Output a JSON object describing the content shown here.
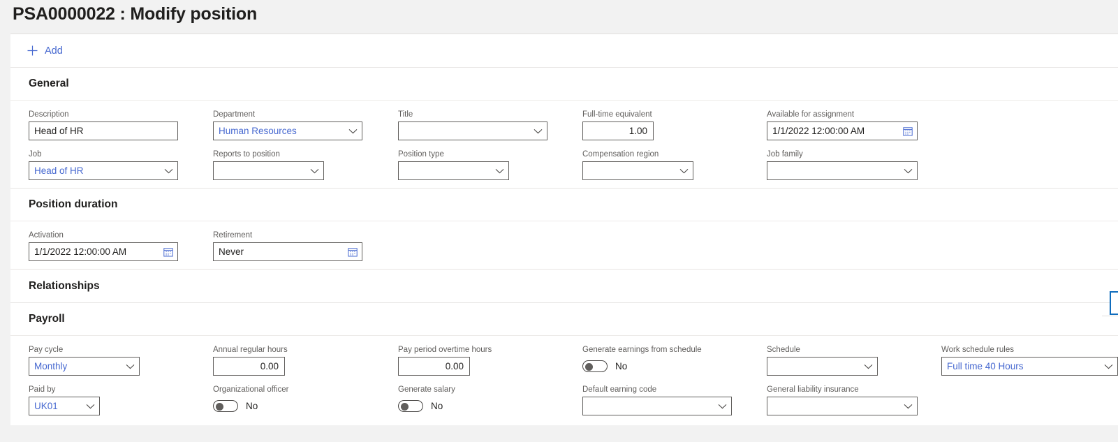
{
  "page": {
    "title": "PSA0000022 : Modify position"
  },
  "colors": {
    "accent": "#4668d0",
    "focus": "#0f6cbd",
    "label": "#605e5c",
    "text": "#201f1e"
  },
  "toolbar": {
    "add_label": "Add",
    "add_icon": "plus-icon"
  },
  "sections": {
    "general": {
      "title": "General",
      "fields": {
        "description": {
          "label": "Description",
          "value": "Head of HR"
        },
        "department": {
          "label": "Department",
          "value": "Human Resources"
        },
        "title": {
          "label": "Title",
          "value": ""
        },
        "fte": {
          "label": "Full-time equivalent",
          "value": "1.00"
        },
        "available": {
          "label": "Available for assignment",
          "value": "1/1/2022 12:00:00 AM"
        },
        "job": {
          "label": "Job",
          "value": "Head of HR"
        },
        "reports_to": {
          "label": "Reports to position",
          "value": ""
        },
        "position_type": {
          "label": "Position type",
          "value": ""
        },
        "comp_region": {
          "label": "Compensation region",
          "value": ""
        },
        "job_family": {
          "label": "Job family",
          "value": ""
        }
      }
    },
    "position_duration": {
      "title": "Position duration",
      "fields": {
        "activation": {
          "label": "Activation",
          "value": "1/1/2022 12:00:00 AM"
        },
        "retirement": {
          "label": "Retirement",
          "value": "Never"
        }
      }
    },
    "relationships": {
      "title": "Relationships"
    },
    "payroll": {
      "title": "Payroll",
      "fields": {
        "pay_cycle": {
          "label": "Pay cycle",
          "value": "Monthly"
        },
        "annual_hours": {
          "label": "Annual regular hours",
          "value": "0.00"
        },
        "overtime_hours": {
          "label": "Pay period overtime hours",
          "value": "0.00"
        },
        "gen_earnings": {
          "label": "Generate earnings from schedule",
          "value": "No"
        },
        "schedule": {
          "label": "Schedule",
          "value": ""
        },
        "work_rules": {
          "label": "Work schedule rules",
          "value": "Full time 40 Hours"
        },
        "paid_by": {
          "label": "Paid by",
          "value": "UK01"
        },
        "org_officer": {
          "label": "Organizational officer",
          "value": "No"
        },
        "gen_salary": {
          "label": "Generate salary",
          "value": "No"
        },
        "earning_code": {
          "label": "Default earning code",
          "value": ""
        },
        "liability_ins": {
          "label": "General liability insurance",
          "value": ""
        }
      }
    }
  }
}
